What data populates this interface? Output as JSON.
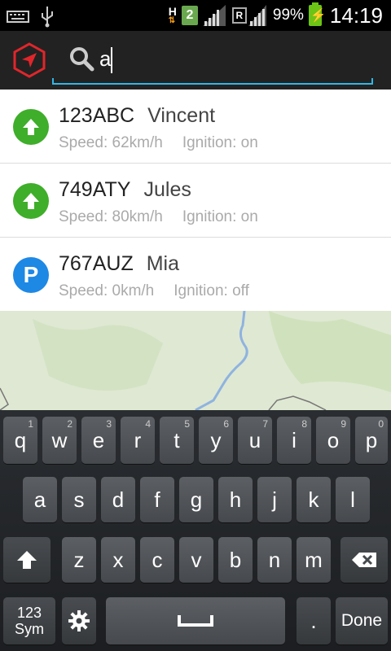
{
  "status_bar": {
    "network_type": "H",
    "sim_slot": "2",
    "roaming_badge": "R",
    "battery_percent": "99%",
    "time": "14:19",
    "icons": [
      "keyboard-icon",
      "usb-icon",
      "data-activity-icon",
      "signal-icon",
      "battery-charging-icon"
    ]
  },
  "app_bar": {
    "logo": "navigation-arrow-hexagon-logo",
    "search": {
      "value": "a",
      "icon": "search-icon"
    }
  },
  "results": [
    {
      "plate": "123ABC",
      "driver": "Vincent",
      "speed": "Speed: 62km/h",
      "ignition": "Ignition: on",
      "status": "moving",
      "status_icon": "arrow-up-icon",
      "color": "#3fae2a"
    },
    {
      "plate": "749ATY",
      "driver": "Jules",
      "speed": "Speed: 80km/h",
      "ignition": "Ignition: on",
      "status": "moving",
      "status_icon": "arrow-up-icon",
      "color": "#3fae2a"
    },
    {
      "plate": "767AUZ",
      "driver": "Mia",
      "speed": "Speed: 0km/h",
      "ignition": "Ignition: off",
      "status": "parked",
      "status_icon": "parking-icon",
      "status_label": "P",
      "color": "#1e88e5"
    }
  ],
  "keyboard": {
    "row1": [
      {
        "key": "q",
        "num": "1"
      },
      {
        "key": "w",
        "num": "2"
      },
      {
        "key": "e",
        "num": "3"
      },
      {
        "key": "r",
        "num": "4"
      },
      {
        "key": "t",
        "num": "5"
      },
      {
        "key": "y",
        "num": "6"
      },
      {
        "key": "u",
        "num": "7"
      },
      {
        "key": "i",
        "num": "8"
      },
      {
        "key": "o",
        "num": "9"
      },
      {
        "key": "p",
        "num": "0"
      }
    ],
    "row2": [
      "a",
      "s",
      "d",
      "f",
      "g",
      "h",
      "j",
      "k",
      "l"
    ],
    "row3": [
      "z",
      "x",
      "c",
      "v",
      "b",
      "n",
      "m"
    ],
    "sym_label_1": "123",
    "sym_label_2": "Sym",
    "period": ".",
    "done": "Done"
  },
  "colors": {
    "accent": "#33b5e5",
    "moving": "#3fae2a",
    "parked": "#1e88e5",
    "logo_red": "#e0262b"
  }
}
